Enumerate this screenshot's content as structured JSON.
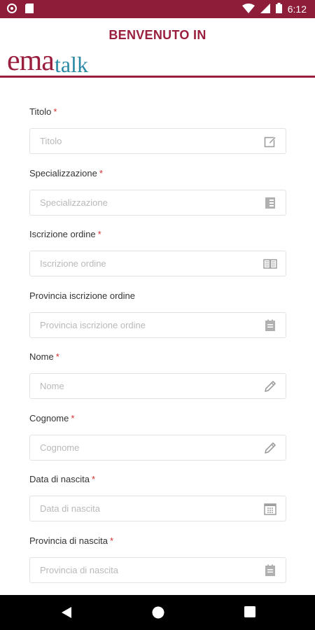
{
  "status_bar": {
    "time": "6:12",
    "icons": [
      "alarm-icon",
      "sim-card-icon",
      "wifi-icon",
      "signal-icon",
      "battery-icon"
    ]
  },
  "header": {
    "title": "BENVENUTO IN",
    "logo_primary": "ema",
    "logo_secondary": "talk",
    "brand_color": "#9a1f3f",
    "accent_color": "#2a8aa5"
  },
  "form": {
    "fields": [
      {
        "label": "Titolo",
        "required": true,
        "placeholder": "Titolo",
        "value": "",
        "icon": "edit-box-icon"
      },
      {
        "label": "Specializzazione",
        "required": true,
        "placeholder": "Specializzazione",
        "value": "",
        "icon": "badge-icon"
      },
      {
        "label": "Iscrizione ordine",
        "required": true,
        "placeholder": "Iscrizione ordine",
        "value": "",
        "icon": "book-icon"
      },
      {
        "label": "Provincia iscrizione ordine",
        "required": false,
        "placeholder": "Provincia iscrizione ordine",
        "value": "",
        "icon": "list-box-icon"
      },
      {
        "label": "Nome",
        "required": true,
        "placeholder": "Nome",
        "value": "",
        "icon": "pencil-icon"
      },
      {
        "label": "Cognome",
        "required": true,
        "placeholder": "Cognome",
        "value": "",
        "icon": "pencil-icon"
      },
      {
        "label": "Data di nascita",
        "required": true,
        "placeholder": "Data di nascita",
        "value": "",
        "icon": "calendar-icon"
      },
      {
        "label": "Provincia di nascita",
        "required": true,
        "placeholder": "Provincia di nascita",
        "value": "",
        "icon": "list-box-icon"
      }
    ],
    "required_marker": "*"
  },
  "nav_bar": {
    "buttons": [
      "back-icon",
      "home-icon",
      "recents-icon"
    ]
  }
}
